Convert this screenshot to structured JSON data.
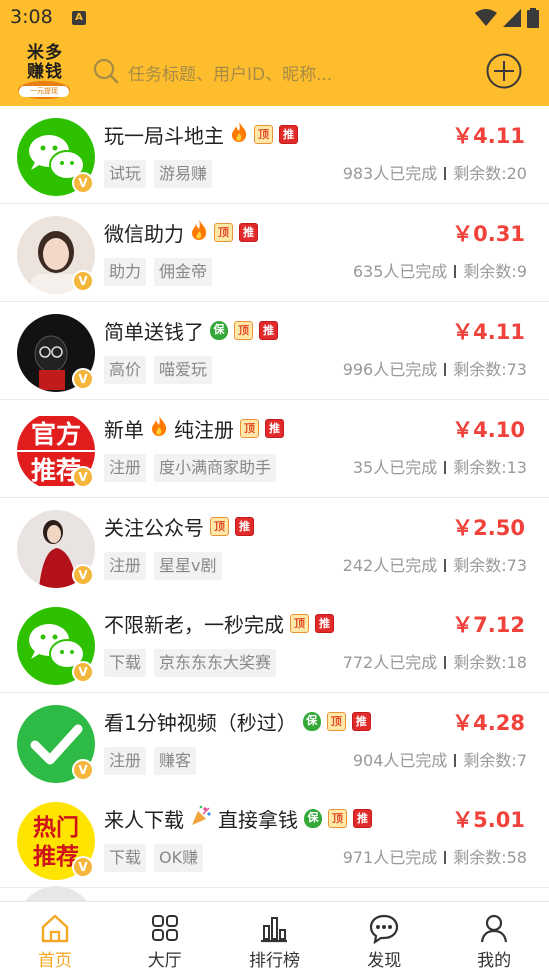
{
  "status_bar": {
    "time": "3:08",
    "notification_icon": "A"
  },
  "header": {
    "logo_text": "米多赚钱",
    "logo_sub": "一元提现",
    "search_placeholder": "任务标题、用户ID、昵称...",
    "add_icon": "plus-circle-icon"
  },
  "colors": {
    "brand": "#fdbd2c",
    "price": "#f0413a",
    "active_tab": "#f5a623"
  },
  "tasks": [
    {
      "title": "玩一局斗地主",
      "fire": true,
      "bao": false,
      "price": "￥4.11",
      "chips": [
        "试玩",
        "游易赚"
      ],
      "done": "983人已完成",
      "remain": "剩余数:20",
      "avatar": "wechat-green"
    },
    {
      "title": "微信助力",
      "fire": true,
      "bao": false,
      "price": "￥0.31",
      "chips": [
        "助力",
        "佣金帝"
      ],
      "done": "635人已完成",
      "remain": "剩余数:9",
      "avatar": "photo-girl"
    },
    {
      "title": "简单送钱了",
      "fire": false,
      "bao": true,
      "price": "￥4.11",
      "chips": [
        "高价",
        "喵爱玩"
      ],
      "done": "996人已完成",
      "remain": "剩余数:73",
      "avatar": "cartoon-dark"
    },
    {
      "title": "新单",
      "title2": "纯注册",
      "fire": true,
      "bao": false,
      "price": "￥4.10",
      "chips": [
        "注册",
        "度小满商家助手"
      ],
      "done": "35人已完成",
      "remain": "剩余数:13",
      "avatar": "official-red"
    },
    {
      "title": "关注公众号",
      "fire": false,
      "bao": false,
      "price": "￥2.50",
      "chips": [
        "注册",
        "星星v剧"
      ],
      "done": "242人已完成",
      "remain": "剩余数:73",
      "avatar": "photo-woman"
    },
    {
      "title": "不限新老，一秒完成",
      "fire": false,
      "bao": false,
      "price": "￥7.12",
      "chips": [
        "下载",
        "京东东东大奖赛"
      ],
      "done": "772人已完成",
      "remain": "剩余数:18",
      "avatar": "wechat-green"
    },
    {
      "title": "看1分钟视频（秒过）",
      "fire": false,
      "bao": true,
      "price": "￥4.28",
      "chips": [
        "注册",
        "赚客"
      ],
      "done": "904人已完成",
      "remain": "剩余数:7",
      "avatar": "check-green"
    },
    {
      "title": "来人下载",
      "title2": "直接拿钱",
      "fire": false,
      "party": true,
      "bao": true,
      "price": "￥5.01",
      "chips": [
        "下载",
        "OK赚"
      ],
      "done": "971人已完成",
      "remain": "剩余数:58",
      "avatar": "hot-yellow"
    }
  ],
  "tag_labels": {
    "ding": "顶",
    "tui": "推",
    "bao": "保",
    "v": "V"
  },
  "avatar_text": {
    "official": [
      "官方",
      "推荐"
    ],
    "hot": [
      "热门",
      "推荐"
    ]
  },
  "tabs": [
    {
      "label": "首页",
      "icon": "home-icon",
      "active": true
    },
    {
      "label": "大厅",
      "icon": "grid-icon",
      "active": false
    },
    {
      "label": "排行榜",
      "icon": "bar-chart-icon",
      "active": false
    },
    {
      "label": "发现",
      "icon": "chat-bubble-icon",
      "active": false
    },
    {
      "label": "我的",
      "icon": "user-icon",
      "active": false
    }
  ]
}
